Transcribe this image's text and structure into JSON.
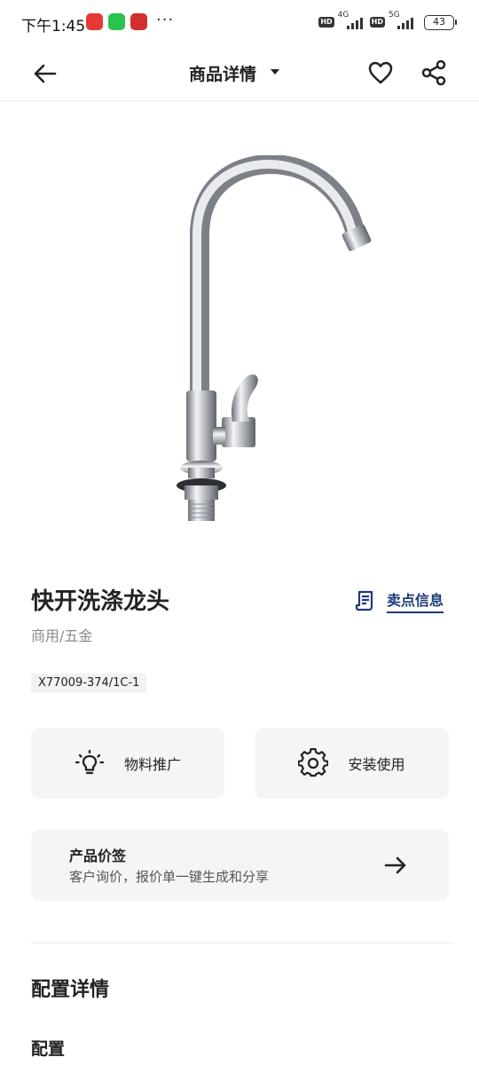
{
  "status_bar": {
    "time": "下午1:45",
    "dots": "···",
    "net1": "4G",
    "net2": "5G",
    "hd": "HD",
    "battery": "43"
  },
  "header": {
    "title": "商品详情",
    "back_icon": "arrow-left-icon",
    "caret_icon": "caret-down-icon",
    "fav_icon": "heart-icon",
    "share_icon": "share-icon"
  },
  "product": {
    "title": "快开洗涤龙头",
    "category": "商用/五金",
    "model": "X77009-374/1C-1",
    "selling_points_label": "卖点信息",
    "accent_color": "#1e3a78"
  },
  "actions": {
    "promo_label": "物料推广",
    "install_label": "安装使用"
  },
  "price_tag": {
    "title": "产品价签",
    "subtitle": "客户询价，报价单一键生成和分享"
  },
  "config": {
    "section_title": "配置详情",
    "sub_title": "配置"
  }
}
